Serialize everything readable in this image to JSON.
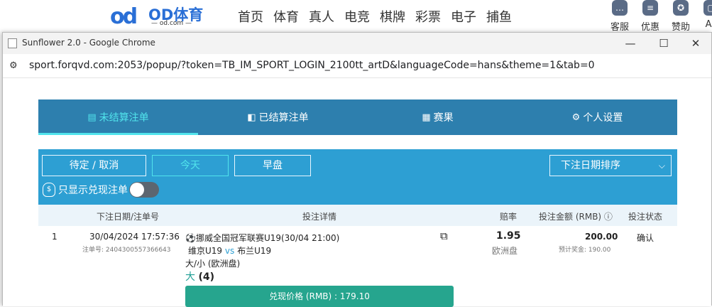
{
  "site": {
    "logo_mark": "od",
    "brand": "OD体育",
    "brand_sub": "— od.com —",
    "nav": [
      "首页",
      "体育",
      "真人",
      "电竞",
      "棋牌",
      "彩票",
      "电子",
      "捕鱼"
    ],
    "tools": [
      {
        "label": "客服",
        "icon": "chat-icon"
      },
      {
        "label": "优惠",
        "icon": "gift-icon"
      },
      {
        "label": "赞助",
        "icon": "medal-icon"
      },
      {
        "label": "AP",
        "icon": "app-icon"
      }
    ]
  },
  "window": {
    "title": "Sunflower 2.0 - Google Chrome",
    "minimize": "—",
    "maximize": "☐",
    "close": "✕",
    "url": "sport.forqvd.com:2053/popup/?token=TB_IM_SPORT_LOGIN_2100tt_artD&languageCode=hans&theme=1&tab=0"
  },
  "tabs": [
    {
      "label": "未结算注单",
      "icon": "receipt-icon",
      "active": true
    },
    {
      "label": "已结算注单",
      "icon": "settled-icon",
      "active": false
    },
    {
      "label": "赛果",
      "icon": "scoreboard-icon",
      "active": false
    },
    {
      "label": "个人设置",
      "icon": "gear-icon",
      "active": false
    }
  ],
  "filters": {
    "pending": "待定 / 取消",
    "today": "今天",
    "early": "早盘",
    "sort": "下注日期排序",
    "cashout_toggle_label": "只显示兑现注单",
    "cashout_toggle_on": false
  },
  "table": {
    "headers": {
      "date": "下注日期/注单号",
      "details": "投注详情",
      "odds": "赔率",
      "amount": "投注金额 (RMB) ⓘ",
      "status": "投注状态"
    },
    "rows": [
      {
        "index": "1",
        "date": "30/04/2024 17:57:36",
        "bet_no": "注单号: 2404300557366643",
        "league": "⚽挪威全国冠军联赛U19(30/04 21:00)",
        "home": "维京U19",
        "vs": "vs",
        "away": "布兰U19",
        "market": "大/小 (欧洲盘)",
        "selection": "大",
        "line": "(4)",
        "odds": "1.95",
        "odds_type": "欧洲盘",
        "amount": "200.00",
        "est_win": "预计奖金: 190.00",
        "status": "确认",
        "cashout": "兑现价格 (RMB) : 179.10"
      }
    ]
  },
  "colors": {
    "tab_bg": "#2d7fae",
    "filter_bg": "#2d9fd3",
    "accent": "#51e4ec",
    "cashout_green": "#26a58e",
    "selection_teal": "#1e9e94"
  }
}
